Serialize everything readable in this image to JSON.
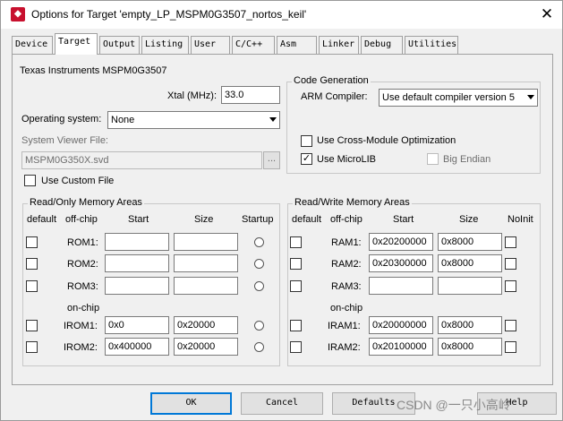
{
  "window": {
    "title": "Options for Target 'empty_LP_MSPM0G3507_nortos_keil'"
  },
  "tabs": [
    "Device",
    "Target",
    "Output",
    "Listing",
    "User",
    "C/C++",
    "Asm",
    "Linker",
    "Debug",
    "Utilities"
  ],
  "active_tab": "Target",
  "device": {
    "name": "Texas Instruments MSPM0G3507",
    "xtal_label": "Xtal (MHz):",
    "xtal_value": "33.0",
    "os_label": "Operating system:",
    "os_value": "None",
    "svd_label": "System Viewer File:",
    "svd_value": "MSPM0G350X.svd",
    "browse_label": "...",
    "custom_file_label": "Use Custom File"
  },
  "code_gen": {
    "title": "Code Generation",
    "compiler_label": "ARM Compiler:",
    "compiler_value": "Use default compiler version 5",
    "cross_module_label": "Use Cross-Module Optimization",
    "cross_module_checked": false,
    "microlib_label": "Use MicroLIB",
    "microlib_checked": true,
    "big_endian_label": "Big Endian",
    "big_endian_checked": false
  },
  "ro_memory": {
    "title": "Read/Only Memory Areas",
    "headers": [
      "default",
      "off-chip",
      "Start",
      "Size",
      "Startup"
    ],
    "onchip_label": "on-chip",
    "rows": [
      {
        "label": "ROM1:",
        "start": "",
        "size": "",
        "default": false,
        "startup": false
      },
      {
        "label": "ROM2:",
        "start": "",
        "size": "",
        "default": false,
        "startup": false
      },
      {
        "label": "ROM3:",
        "start": "",
        "size": "",
        "default": false,
        "startup": false
      },
      {
        "label": "IROM1:",
        "start": "0x0",
        "size": "0x20000",
        "default": false,
        "startup": false
      },
      {
        "label": "IROM2:",
        "start": "0x400000",
        "size": "0x20000",
        "default": false,
        "startup": false
      }
    ]
  },
  "rw_memory": {
    "title": "Read/Write Memory Areas",
    "headers": [
      "default",
      "off-chip",
      "Start",
      "Size",
      "NoInit"
    ],
    "onchip_label": "on-chip",
    "rows": [
      {
        "label": "RAM1:",
        "start": "0x20200000",
        "size": "0x8000",
        "default": false,
        "noinit": false
      },
      {
        "label": "RAM2:",
        "start": "0x20300000",
        "size": "0x8000",
        "default": false,
        "noinit": false
      },
      {
        "label": "RAM3:",
        "start": "",
        "size": "",
        "default": false,
        "noinit": false
      },
      {
        "label": "IRAM1:",
        "start": "0x20000000",
        "size": "0x8000",
        "default": false,
        "noinit": false
      },
      {
        "label": "IRAM2:",
        "start": "0x20100000",
        "size": "0x8000",
        "default": false,
        "noinit": false
      }
    ]
  },
  "buttons": {
    "ok": "OK",
    "cancel": "Cancel",
    "defaults": "Defaults",
    "help": "Help"
  },
  "watermark": "CSDN @一只小高岭"
}
